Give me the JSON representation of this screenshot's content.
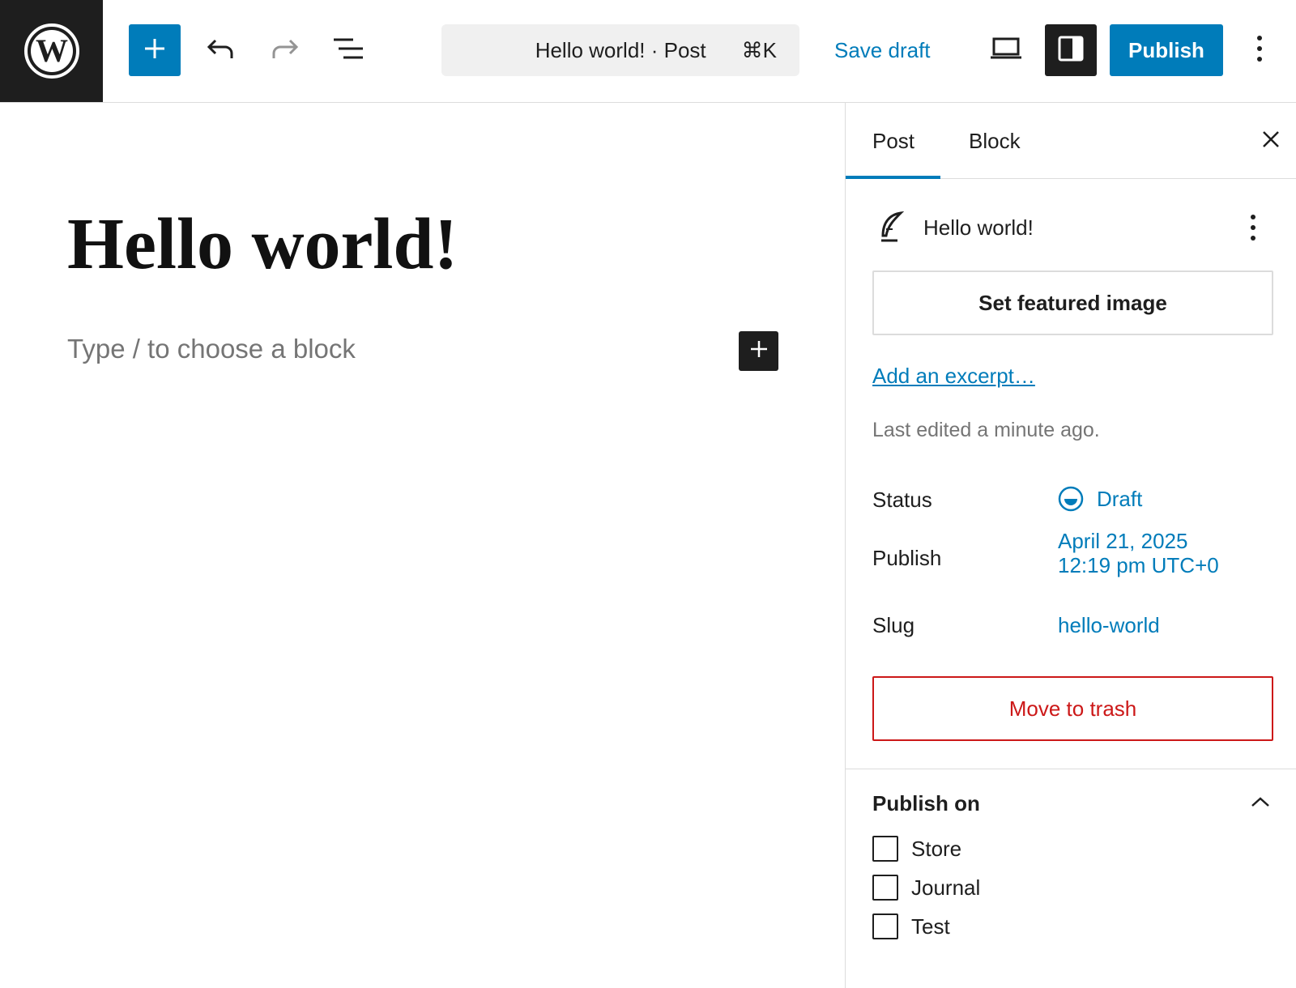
{
  "topbar": {
    "logo_icon": "wordpress-logo",
    "inserter_icon": "plus-icon",
    "undo_icon": "undo-icon",
    "redo_icon": "redo-icon",
    "list_view_icon": "list-view-icon",
    "command_title": "Hello world! · Post",
    "command_shortcut": "⌘K",
    "save_draft_label": "Save draft",
    "preview_icon": "desktop-preview-icon",
    "settings_icon": "sidebar-toggle-icon",
    "publish_label": "Publish",
    "more_icon": "more-vertical-icon"
  },
  "editor": {
    "post_title": "Hello world!",
    "block_placeholder": "Type / to choose a block",
    "block_add_icon": "plus-icon"
  },
  "sidebar": {
    "tabs": [
      {
        "label": "Post",
        "active": true
      },
      {
        "label": "Block",
        "active": false
      }
    ],
    "close_icon": "close-icon",
    "post_card": {
      "icon": "feather-icon",
      "title": "Hello world!",
      "menu_icon": "more-vertical-icon"
    },
    "featured_image_label": "Set featured image",
    "excerpt_link": "Add an excerpt…",
    "last_edited": "Last edited a minute ago.",
    "meta": {
      "status_label": "Status",
      "status_value": "Draft",
      "publish_label": "Publish",
      "publish_date": "April 21, 2025",
      "publish_time": "12:19 pm UTC+0",
      "slug_label": "Slug",
      "slug_value": "hello-world"
    },
    "trash_label": "Move to trash",
    "publish_on": {
      "title": "Publish on",
      "toggle_icon": "chevron-up-icon",
      "options": [
        {
          "label": "Store",
          "checked": false
        },
        {
          "label": "Journal",
          "checked": false
        },
        {
          "label": "Test",
          "checked": false
        }
      ]
    }
  },
  "colors": {
    "accent": "#007cba",
    "dark": "#1e1e1e",
    "danger": "#cc1818",
    "muted": "#757575"
  }
}
